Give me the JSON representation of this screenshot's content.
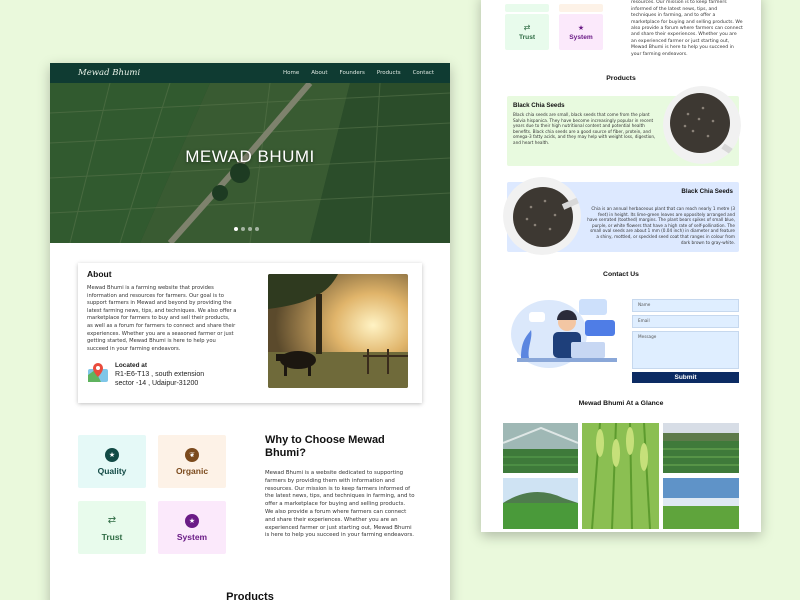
{
  "site": {
    "brand": "Mewad Bhumi",
    "nav": [
      "Home",
      "About",
      "Founders",
      "Products",
      "Contact"
    ],
    "hero_title": "MEWAD BHUMI"
  },
  "about": {
    "heading": "About",
    "text": "Mewad Bhumi is a farming website that provides information and resources for farmers. Our goal is to support farmers in Mewad and beyond by providing the latest farming news, tips, and techniques. We also offer a marketplace for farmers to buy and sell their products, as well as a forum for farmers to connect and share their experiences. Whether you are a seasoned farmer or just getting started, Mewad Bhumi is here to help you succeed in your farming endeavors.",
    "located_label": "Located at",
    "address1": "R1-E6-T13 , south extension",
    "address2": "sector -14 , Udaipur-31200"
  },
  "features": {
    "quality": "Quality",
    "organic": "Organic",
    "trust": "Trust",
    "system": "System"
  },
  "why": {
    "heading": "Why to Choose Mewad Bhumi?",
    "text": "Mewad Bhumi is a website dedicated to supporting farmers by providing them with information and resources. Our mission is to keep farmers informed of the latest news, tips, and techniques in farming, and to offer a marketplace for buying and selling products. We also provide a forum where farmers can connect and share their experiences. Whether you are an experienced farmer or just starting out, Mewad Bhumi is here to help you succeed in your farming endeavors."
  },
  "products": {
    "heading": "Products"
  },
  "right": {
    "top_text": "farmers by providing them with information and resources. Our mission is to keep farmers informed of the latest news, tips, and techniques in farming, and to offer a marketplace for buying and selling products. We also provide a forum where farmers can connect and share their experiences. Whether you are an experienced farmer or just starting out, Mewad Bhumi is here to help you succeed in your farming endeavors.",
    "trust": "Trust",
    "system": "System",
    "products_heading": "Products",
    "seed1_title": "Black Chia Seeds",
    "seed1_text": "Black chia seeds are small, black seeds that come from the plant Salvia hispanica. They have become increasingly popular in recent years due to their high nutritional content and potential health benefits. Black chia seeds are a good source of fiber, protein, and omega-3 fatty acids, and they may help with weight loss, digestion, and heart health.",
    "seed2_title": "Black Chia Seeds",
    "seed2_text": "Chia is an annual herbaceous plant that can reach nearly 1 metre (3 feet) in height. Its lime-green leaves are oppositely arranged and have serrated (toothed) margins. The plant bears spikes of small blue, purple, or white flowers that have a high rate of self-pollination. The small oval seeds are about 1 mm (0.04 inch) in diameter and feature a shiny, mottled, or speckled seed coat that ranges in colour from dark brown to gray-white.",
    "contact_heading": "Contact Us",
    "name_ph": "Name",
    "email_ph": "Email",
    "message_ph": "Message",
    "submit": "Submit",
    "glance_heading": "Mewad Bhumi At a Glance"
  },
  "colors": {
    "nav": "#0f3b32",
    "background": "#eaf9dc",
    "submit": "#0c2b63"
  }
}
